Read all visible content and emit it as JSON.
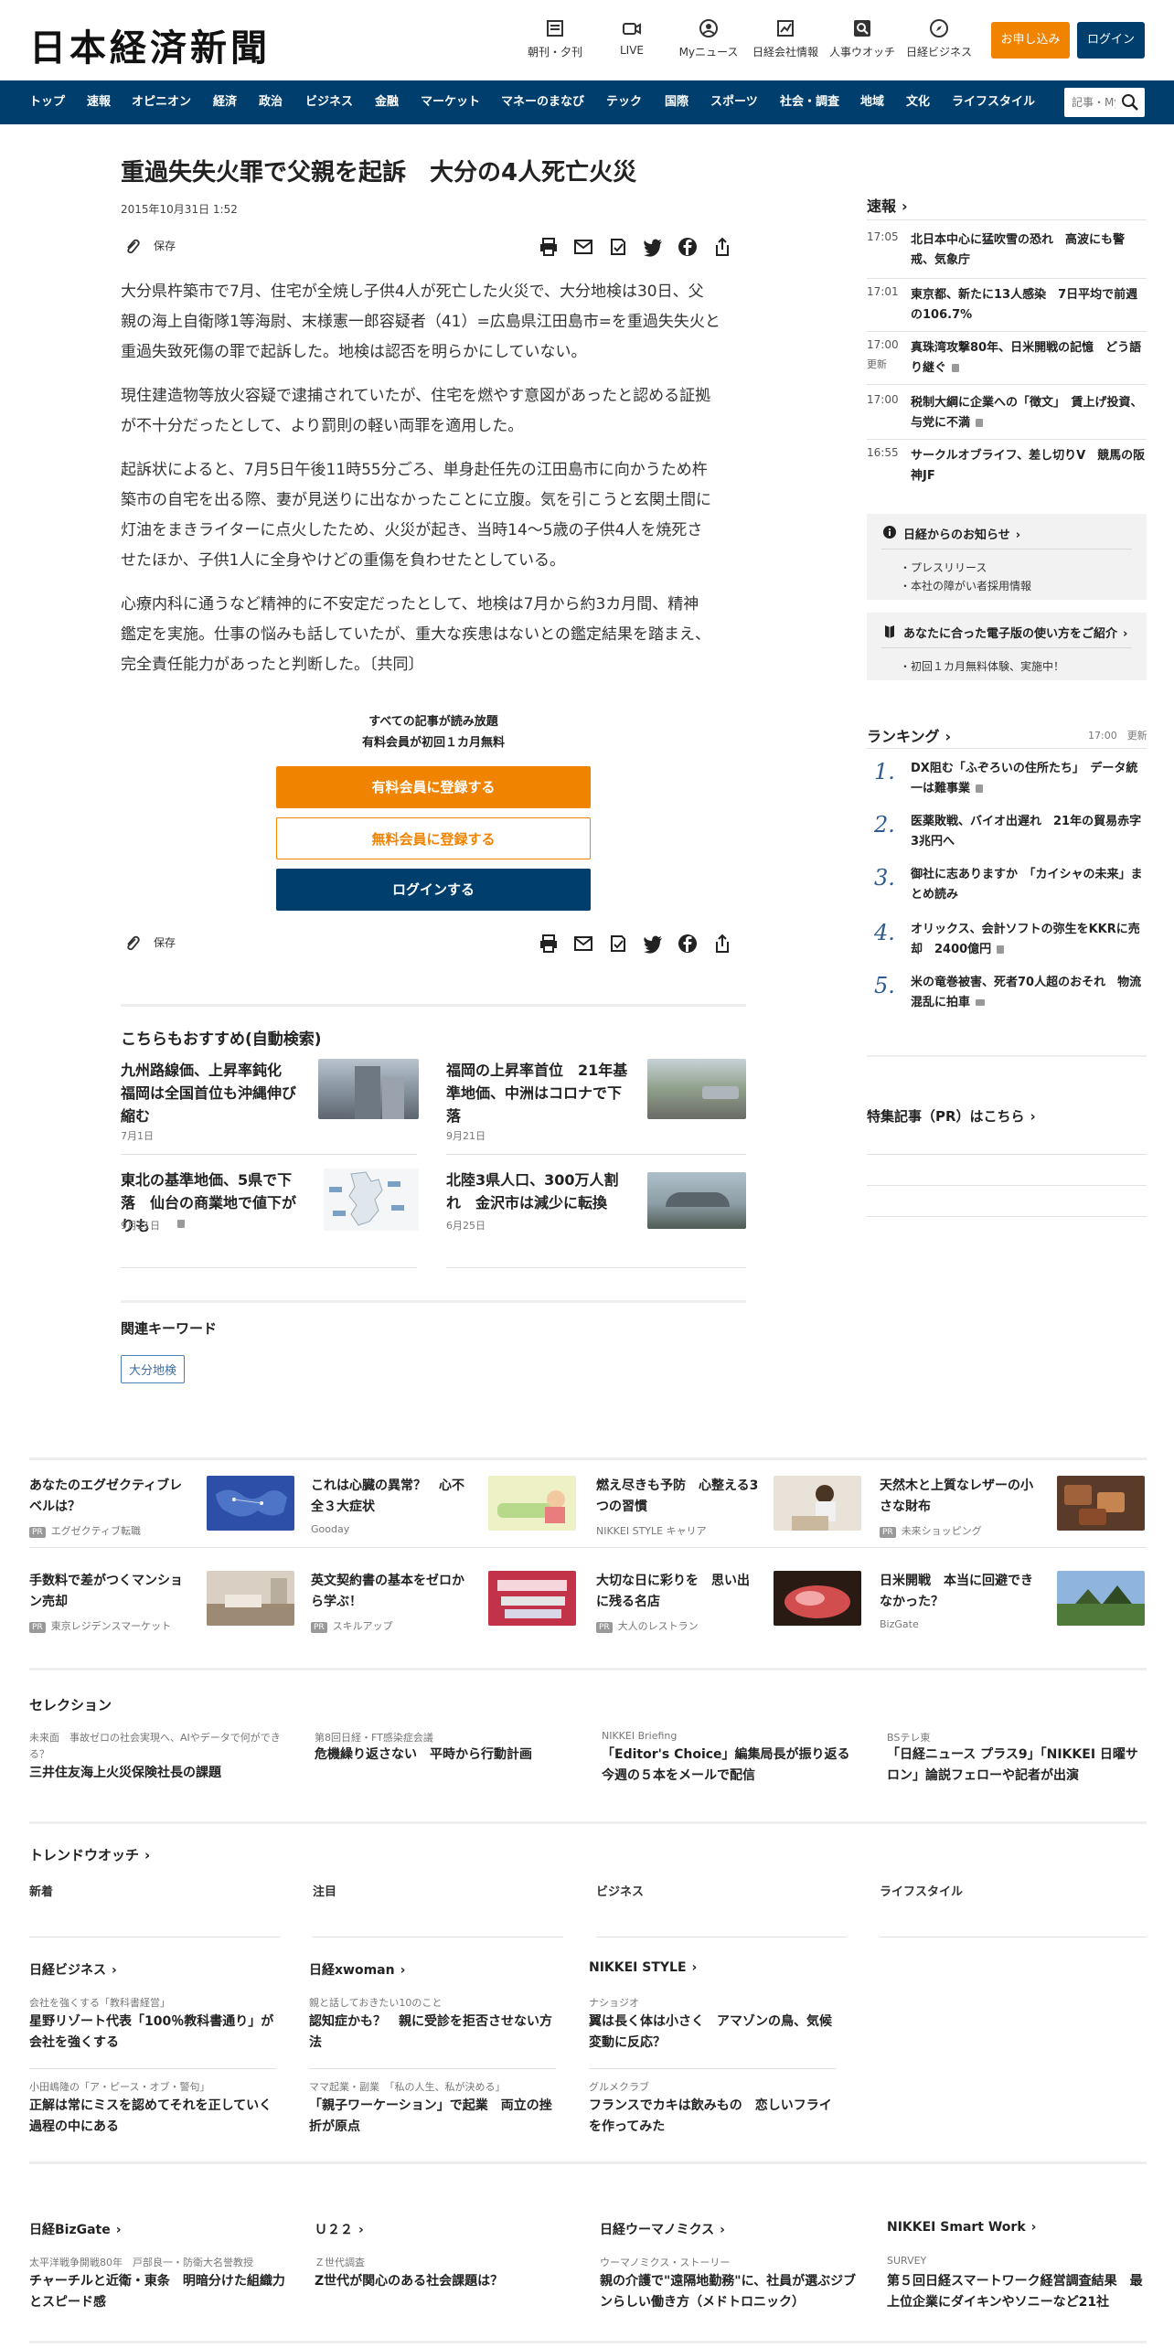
{
  "header": {
    "logo": "日本経済新聞",
    "icons": [
      {
        "label": "朝刊・夕刊",
        "icon": "newspaper-icon"
      },
      {
        "label": "LIVE",
        "icon": "video-icon"
      },
      {
        "label": "Myニュース",
        "icon": "user-icon"
      },
      {
        "label": "日経会社情報",
        "icon": "chart-icon"
      },
      {
        "label": "人事ウオッチ",
        "icon": "search-person-icon"
      },
      {
        "label": "日経ビジネス",
        "icon": "compass-icon"
      }
    ],
    "subscribe": "お申し込み",
    "login": "ログイン"
  },
  "nav": {
    "items": [
      "トップ",
      "速報",
      "オピニオン",
      "経済",
      "政治",
      "ビジネス",
      "金融",
      "マーケット",
      "マネーのまなび",
      "テック",
      "国際",
      "スポーツ",
      "社会・調査",
      "地域",
      "文化",
      "ライフスタイル"
    ],
    "search_placeholder": "記事・Myニュース"
  },
  "article": {
    "title": "重過失失火罪で父親を起訴　大分の4人死亡火災",
    "date": "2015年10月31日 1:52",
    "save": "保存",
    "paragraphs": [
      [
        "大分県杵築市で7月、住宅が全焼し子供4人が死亡した火災で、大分地検は30日、父",
        "親の海上自衛隊1等海尉、末様憲一郎容疑者（41）=広島県江田島市=を重過失失火と",
        "重過失致死傷の罪で起訴した。地検は認否を明らかにしていない。"
      ],
      [
        "現住建造物等放火容疑で逮捕されていたが、住宅を燃やす意図があったと認める証拠",
        "が不十分だったとして、より罰則の軽い両罪を適用した。"
      ],
      [
        "起訴状によると、7月5日午後11時55分ごろ、単身赴任先の江田島市に向かうため杵",
        "築市の自宅を出る際、妻が見送りに出なかったことに立腹。気を引こうと玄関土間に",
        "灯油をまきライターに点火したため、火災が起き、当時14～5歳の子供4人を焼死さ",
        "せたほか、子供1人に全身やけどの重傷を負わせたとしている。"
      ],
      [
        "心療内科に通うなど精神的に不安定だったとして、地検は7月から約3カ月間、精神",
        "鑑定を実施。仕事の悩みも話していたが、重大な疾患はないとの鑑定結果を踏まえ、",
        "完全責任能力があったと判断した。〔共同〕"
      ]
    ]
  },
  "cta": {
    "note1": "すべての記事が読み放題",
    "note2": "有料会員が初回１カ月無料",
    "paid": "有料会員に登録する",
    "free": "無料会員に登録する",
    "login": "ログインする"
  },
  "recommend": {
    "heading": "こちらもおすすめ(自動検索)",
    "items": [
      {
        "title": "九州路線価、上昇率鈍化　福岡は全国首位も沖縄伸び縮む",
        "date": "7月1日"
      },
      {
        "title": "福岡の上昇率首位　21年基準地価、中洲はコロナで下落",
        "date": "9月21日"
      },
      {
        "title": "東北の基準地価、5県で下落　仙台の商業地で値下がりも",
        "date": "9月21日"
      },
      {
        "title": "北陸3県人口、300万人割れ　金沢市は減少に転換",
        "date": "6月25日"
      }
    ]
  },
  "keywords": {
    "heading": "関連キーワード",
    "items": [
      "大分地検"
    ]
  },
  "sidebar": {
    "flash_heading": "速報",
    "flash": [
      {
        "time": "17:05",
        "text": "北日本中心に猛吹雪の恐れ　高波にも警戒、気象庁",
        "updated": ""
      },
      {
        "time": "17:01",
        "text": "東京都、新たに13人感染　7日平均で前週の106.7%",
        "updated": ""
      },
      {
        "time": "17:00",
        "text": "真珠湾攻撃80年、日米開戦の記憶　どう語り継ぐ",
        "updated": "更新"
      },
      {
        "time": "17:00",
        "text": "税制大綱に企業への「徴文」　賃上げ投資、与党に不満",
        "updated": ""
      },
      {
        "time": "16:55",
        "text": "サークルオブライフ、差し切りV　競馬の阪神JF",
        "updated": ""
      }
    ],
    "notice_heading": "日経からのお知らせ",
    "notice_items": [
      "プレスリリース",
      "本社の障がい者採用情報"
    ],
    "ebook_heading": "あなたに合った電子版の使い方をご紹介",
    "ebook_items": [
      "初回１カ月無料体験、実施中！"
    ],
    "ranking_heading": "ランキング",
    "ranking_time": "17:00",
    "ranking_update": "更新",
    "ranking": [
      {
        "n": "1.",
        "text": "DX阻む「ふぞろいの住所たち」　データ統一は難事業"
      },
      {
        "n": "2.",
        "text": "医薬敗戦、バイオ出遅れ　21年の貿易赤字3兆円へ"
      },
      {
        "n": "3.",
        "text": "御社に志ありますか　「カイシャの未来」まとめ読み"
      },
      {
        "n": "4.",
        "text": "オリックス、会計ソフトの弥生をKKRに売却　2400億円"
      },
      {
        "n": "5.",
        "text": "米の竜巻被害、死者70人超のおそれ　物流混乱に拍車"
      }
    ],
    "pr_heading": "特集記事（PR）はこちら"
  },
  "ads": [
    {
      "title": "あなたのエグゼクティブレベルは？",
      "source": "エグゼクティブ転職",
      "pr": "PR"
    },
    {
      "title": "これは心臓の異常？　心不全３大症状",
      "source": "Gooday",
      "pr": ""
    },
    {
      "title": "燃え尽きも予防　心整える3つの習慣",
      "source": "NIKKEI STYLE キャリア",
      "pr": ""
    },
    {
      "title": "天然木と上質なレザーの小さな財布",
      "source": "未来ショッピング",
      "pr": "PR"
    },
    {
      "title": "手数料で差がつくマンション売却",
      "source": "東京レジデンスマーケット",
      "pr": "PR"
    },
    {
      "title": "英文契約書の基本をゼロから学ぶ！",
      "source": "スキルアップ",
      "pr": "PR"
    },
    {
      "title": "大切な日に彩りを　思い出に残る名店",
      "source": "大人のレストラン",
      "pr": "PR"
    },
    {
      "title": "日米開戦　本当に回避できなかった？",
      "source": "BizGate",
      "pr": ""
    }
  ],
  "selection": {
    "heading": "セレクション",
    "items": [
      {
        "label": "未来面　事故ゼロの社会実現へ、AIやデータで何ができる？",
        "title": "三井住友海上火災保険社長の課題"
      },
      {
        "label": "第8回日経・FT感染症会議",
        "title": "危機繰り返さない　平時から行動計画"
      },
      {
        "label": "NIKKEI Briefing",
        "title": "「Editor's Choice」編集局長が振り返る今週の５本をメールで配信"
      },
      {
        "label": "BSテレ東",
        "title": "「日経ニュース プラス9」「NIKKEI 日曜サロン」論説フェローや記者が出演"
      }
    ]
  },
  "trend": {
    "heading": "トレンドウオッチ",
    "tabs": [
      "新着",
      "注目",
      "ビジネス",
      "ライフスタイル"
    ]
  },
  "media": [
    {
      "name": "日経ビジネス",
      "items": [
        {
          "label": "会社を強くする「教科書経営」",
          "title": "星野リゾート代表「100％教科書通り」が会社を強くする"
        },
        {
          "label": "小田嶋隆の「ア・ピース・オブ・警句」",
          "title": "正解は常にミスを認めてそれを正していく過程の中にある"
        }
      ]
    },
    {
      "name": "日経xwoman",
      "items": [
        {
          "label": "親と話しておきたい10のこと",
          "title": "認知症かも？　親に受診を拒否させない方法"
        },
        {
          "label": "ママ起業・副業　「私の人生、私が決める」",
          "title": "「親子ワーケーション」で起業　両立の挫折が原点"
        }
      ]
    },
    {
      "name": "NIKKEI STYLE",
      "items": [
        {
          "label": "ナショジオ",
          "title": "翼は長く体は小さく　アマゾンの鳥、気候変動に反応？"
        },
        {
          "label": "グルメクラブ",
          "title": "フランスでカキは飲みもの　恋しいフライを作ってみた"
        }
      ]
    }
  ],
  "media2": [
    {
      "name": "日経BizGate",
      "label": "太平洋戦争開戦80年　戸部良一・防衛大名誉教授",
      "title": "チャーチルと近衛・東条　明暗分けた組織力とスピード感"
    },
    {
      "name": "Ｕ２２",
      "label": "Ｚ世代調査",
      "title": "Z世代が関心のある社会課題は？"
    },
    {
      "name": "日経ウーマノミクス",
      "label": "ウーマノミクス・ストーリー",
      "title": "親の介護で\"遠隔地勤務\"に、社員が選ぶジブンらしい働き方（メドトロニック）"
    },
    {
      "name": "NIKKEI Smart Work",
      "label": "SURVEY",
      "title": "第５回日経スマートワーク経営調査結果　最上位企業にダイキンやソニーなど21社"
    }
  ]
}
